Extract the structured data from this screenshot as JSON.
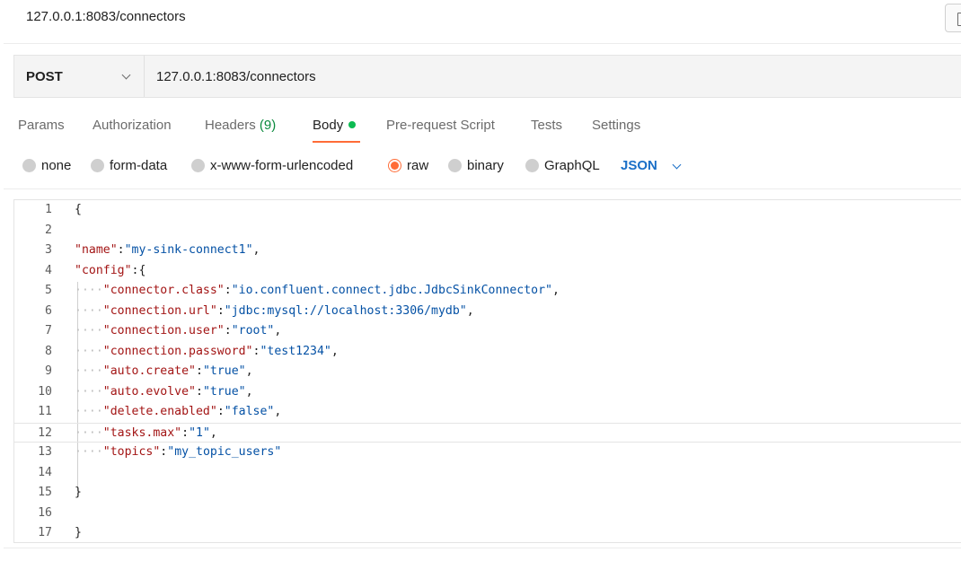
{
  "window": {
    "title": "127.0.0.1:8083/connectors"
  },
  "request": {
    "method": "POST",
    "url": "127.0.0.1:8083/connectors"
  },
  "tabs": [
    {
      "label": "Params"
    },
    {
      "label": "Authorization"
    },
    {
      "label": "Headers",
      "count": "(9)"
    },
    {
      "label": "Body",
      "active": true
    },
    {
      "label": "Pre-request Script"
    },
    {
      "label": "Tests"
    },
    {
      "label": "Settings"
    }
  ],
  "body_types": [
    {
      "label": "none"
    },
    {
      "label": "form-data"
    },
    {
      "label": "x-www-form-urlencoded"
    },
    {
      "label": "raw",
      "selected": true
    },
    {
      "label": "binary"
    },
    {
      "label": "GraphQL"
    }
  ],
  "body_language": "JSON",
  "colors": {
    "accent": "#ff6c37",
    "body_dot": "#0cbb52",
    "link": "#1a6fc7",
    "json_key": "#a31515",
    "json_string": "#0451a5"
  },
  "editor": {
    "line_numbers": [
      "1",
      "2",
      "3",
      "4",
      "5",
      "6",
      "7",
      "8",
      "9",
      "10",
      "11",
      "12",
      "13",
      "14",
      "15",
      "16",
      "17"
    ],
    "brace_open": "{",
    "brace_close": "}",
    "name": {
      "key": "\"name\"",
      "value": "\"my-sink-connect1\""
    },
    "config": {
      "key": "\"config\"",
      "open": "{",
      "close": "}",
      "entries": [
        {
          "key": "\"connector.class\"",
          "value": "\"io.confluent.connect.jdbc.JdbcSinkConnector\""
        },
        {
          "key": "\"connection.url\"",
          "value": "\"jdbc:mysql://localhost:3306/mydb\""
        },
        {
          "key": "\"connection.user\"",
          "value": "\"root\""
        },
        {
          "key": "\"connection.password\"",
          "value": "\"test1234\""
        },
        {
          "key": "\"auto.create\"",
          "value": "\"true\""
        },
        {
          "key": "\"auto.evolve\"",
          "value": "\"true\""
        },
        {
          "key": "\"delete.enabled\"",
          "value": "\"false\""
        },
        {
          "key": "\"tasks.max\"",
          "value": "\"1\""
        },
        {
          "key": "\"topics\"",
          "value": "\"my_topic_users\""
        }
      ]
    }
  }
}
